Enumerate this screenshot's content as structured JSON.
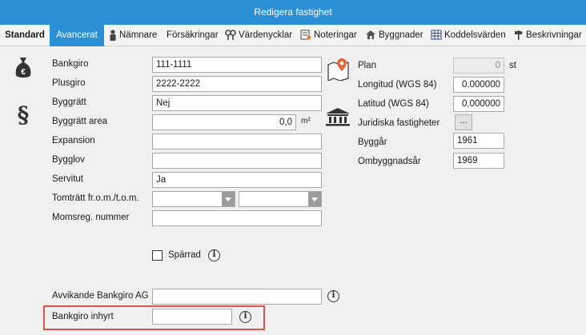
{
  "window": {
    "title": "Redigera fastighet"
  },
  "tabs": {
    "standard": "Standard",
    "avancerat": "Avancerat",
    "namnare": "Nämnare",
    "forsakringar": "Försäkringar",
    "vardenycklar": "Värdenycklar",
    "noteringar": "Noteringar",
    "byggnader": "Byggnader",
    "koddelsvarden": "Koddelsvärden",
    "beskrivningar": "Beskrivningar"
  },
  "left": {
    "bankgiro": {
      "label": "Bankgiro",
      "value": "111-1111"
    },
    "plusgiro": {
      "label": "Plusgiro",
      "value": "2222-2222"
    },
    "byggratt": {
      "label": "Byggrätt",
      "value": "Nej"
    },
    "byggratt_area": {
      "label": "Byggrätt area",
      "value": "0,0",
      "unit": "m²"
    },
    "expansion": {
      "label": "Expansion",
      "value": ""
    },
    "bygglov": {
      "label": "Bygglov",
      "value": ""
    },
    "servitut": {
      "label": "Servitut",
      "value": "Ja"
    },
    "tomtratt": {
      "label": "Tomträtt fr.o.m./t.o.m.",
      "from": "",
      "to": ""
    },
    "momsreg": {
      "label": "Momsreg. nummer",
      "value": ""
    },
    "sparrad": {
      "label": "Spärrad",
      "checked": false
    },
    "avvikande": {
      "label": "Avvikande Bankgiro AG",
      "value": ""
    },
    "bankgiro_inhyrt": {
      "label": "Bankgiro inhyrt",
      "value": ""
    }
  },
  "right": {
    "plan": {
      "label": "Plan",
      "value": "0",
      "unit": "st"
    },
    "longitud": {
      "label": "Longitud (WGS 84)",
      "value": "0,000000"
    },
    "latitud": {
      "label": "Latitud (WGS 84)",
      "value": "0,000000"
    },
    "juridiska": {
      "label": "Juridiska fastigheter",
      "button": "..."
    },
    "byggar": {
      "label": "Byggår",
      "value": "1961"
    },
    "ombyggnadsar": {
      "label": "Ombyggnadsår",
      "value": "1969"
    }
  },
  "icons": {
    "info": "i",
    "money_bag": "€"
  },
  "colors": {
    "accent": "#2b8fd6",
    "highlight": "#d9534f"
  }
}
